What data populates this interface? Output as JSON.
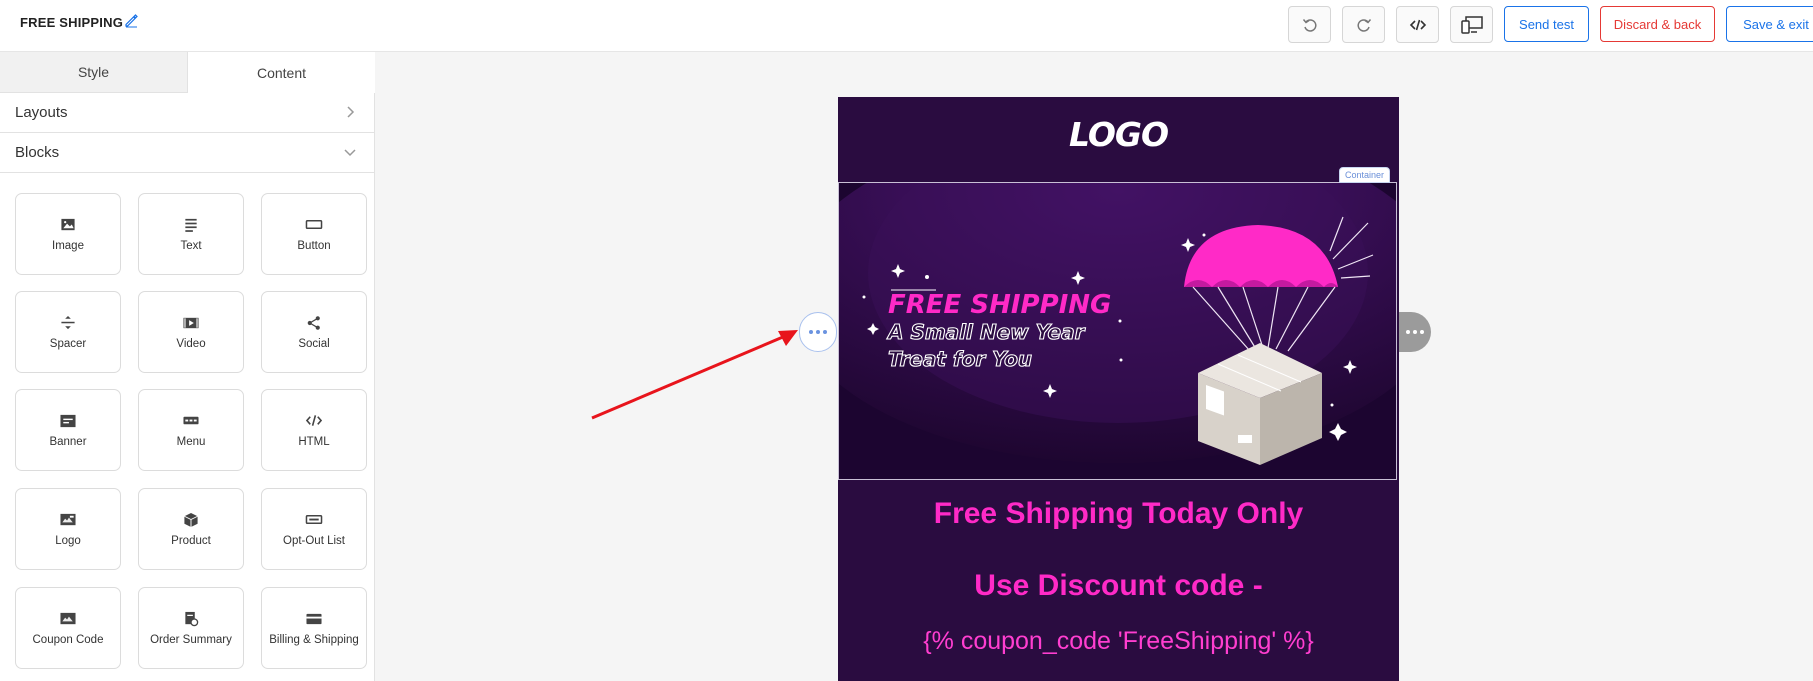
{
  "header": {
    "title": "FREE SHIPPING",
    "undo_icon": "undo-icon",
    "redo_icon": "redo-icon",
    "code_icon": "code-icon",
    "preview_icon": "devices-icon",
    "send_test_label": "Send test",
    "discard_label": "Discard & back",
    "save_label": "Save & exit"
  },
  "sidebar": {
    "tabs": [
      "Style",
      "Content"
    ],
    "active_tab": "Content",
    "layouts_label": "Layouts",
    "blocks_label": "Blocks",
    "blocks": [
      {
        "label": "Image",
        "icon": "image-icon"
      },
      {
        "label": "Text",
        "icon": "text-icon"
      },
      {
        "label": "Button",
        "icon": "button-icon"
      },
      {
        "label": "Spacer",
        "icon": "spacer-icon"
      },
      {
        "label": "Video",
        "icon": "video-icon"
      },
      {
        "label": "Social",
        "icon": "share-icon"
      },
      {
        "label": "Banner",
        "icon": "banner-icon"
      },
      {
        "label": "Menu",
        "icon": "menu-icon"
      },
      {
        "label": "HTML",
        "icon": "html-icon"
      },
      {
        "label": "Logo",
        "icon": "logo-icon"
      },
      {
        "label": "Product",
        "icon": "product-icon"
      },
      {
        "label": "Opt-Out List",
        "icon": "optout-icon"
      },
      {
        "label": "Coupon Code",
        "icon": "coupon-icon"
      },
      {
        "label": "Order Summary",
        "icon": "order-icon"
      },
      {
        "label": "Billing & Shipping",
        "icon": "card-icon"
      }
    ]
  },
  "email": {
    "logo_text": "LOGO",
    "container_badge": "Container",
    "banner_title": "FREE SHIPPING",
    "banner_sub1": "A Small New Year",
    "banner_sub2": "Treat for You",
    "heading": "Free Shipping Today Only",
    "discount_label": "Use Discount code -",
    "coupon_tag": "{% coupon_code 'FreeShipping' %}"
  },
  "colors": {
    "accent": "#1a73e8",
    "danger": "#e53935",
    "email_bg": "#2a0c40",
    "pink": "#ff2ac7"
  }
}
